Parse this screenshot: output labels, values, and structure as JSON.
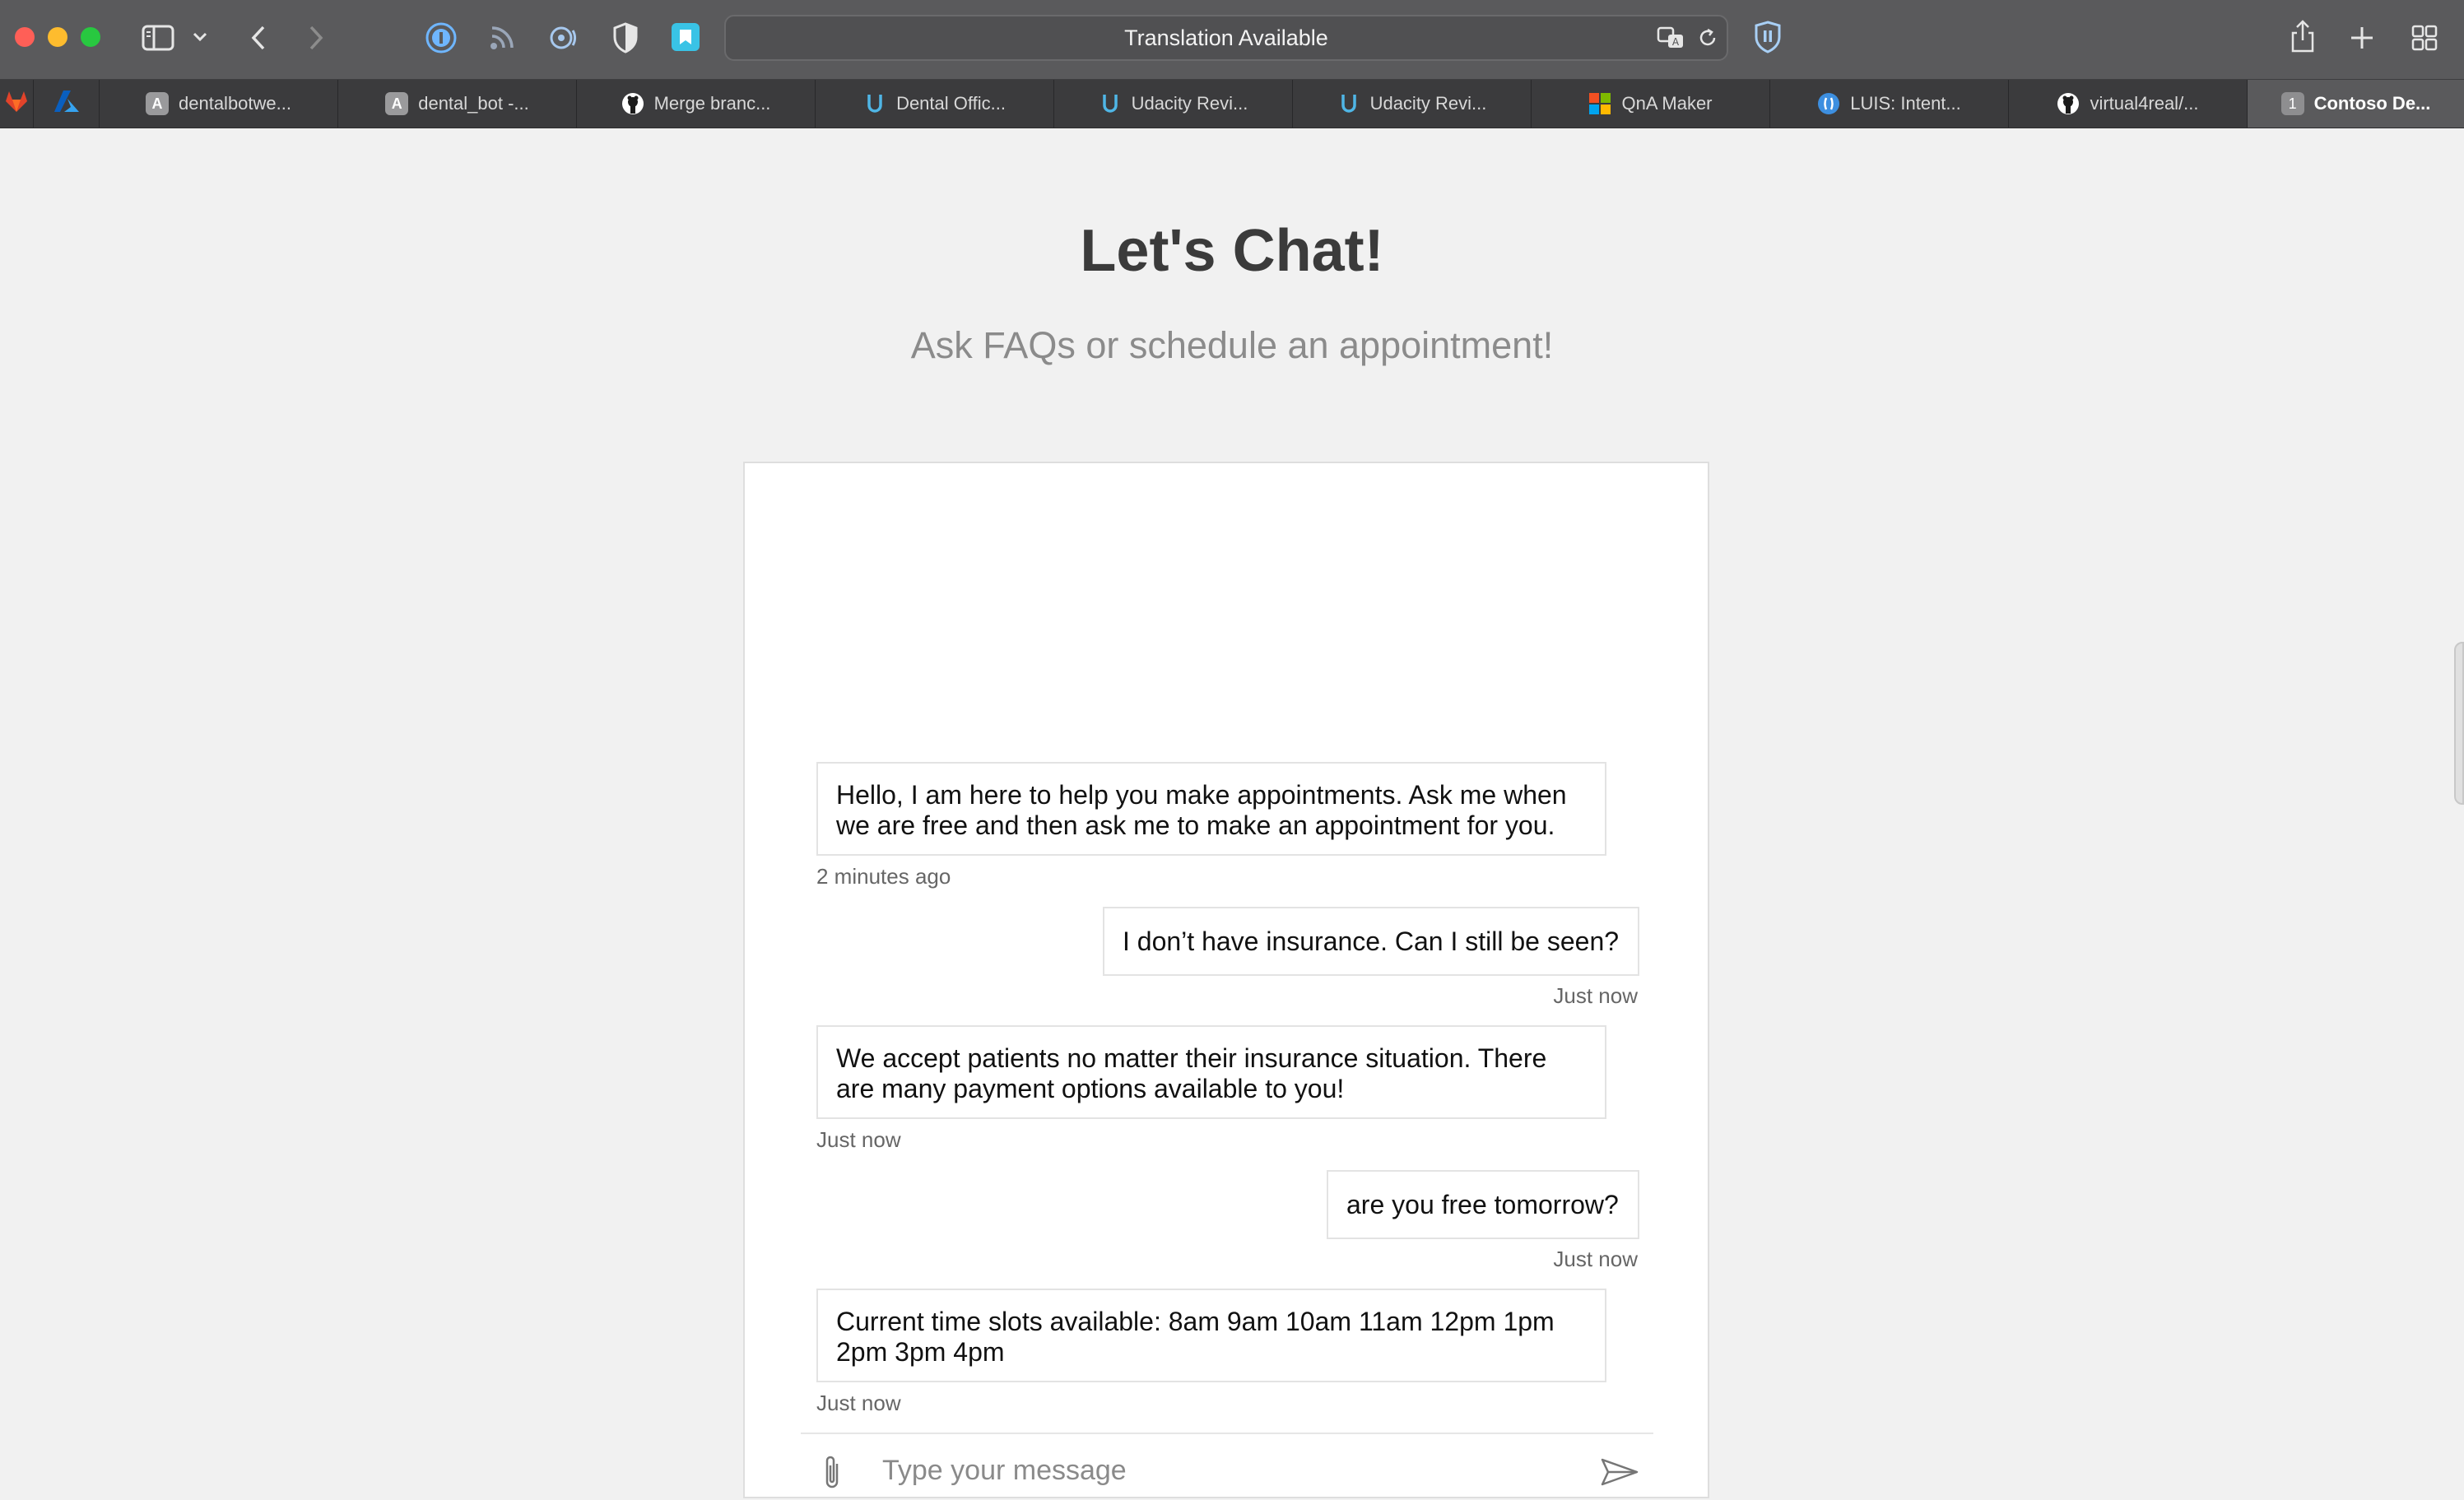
{
  "browser": {
    "address_text": "Translation Available",
    "colors": {
      "toolbar": "#5a5a5c",
      "tabbar": "#3b3b3d",
      "close": "#ff5f57",
      "minimize": "#febc2e",
      "zoom": "#28c840"
    },
    "tabs": [
      {
        "label": "dentalbotwe...",
        "icon": "azure-a-icon"
      },
      {
        "label": "dental_bot -...",
        "icon": "azure-a-icon"
      },
      {
        "label": "Merge branc...",
        "icon": "github-icon"
      },
      {
        "label": "Dental Offic...",
        "icon": "udacity-icon"
      },
      {
        "label": "Udacity Revi...",
        "icon": "udacity-icon"
      },
      {
        "label": "Udacity Revi...",
        "icon": "udacity-icon"
      },
      {
        "label": "QnA Maker",
        "icon": "microsoft-icon"
      },
      {
        "label": "LUIS: Intent...",
        "icon": "luis-icon"
      },
      {
        "label": "virtual4real/...",
        "icon": "github-icon"
      },
      {
        "label": "Contoso De...",
        "icon": "numbered-tab-icon",
        "badge": "1",
        "active": true
      }
    ]
  },
  "page": {
    "title": "Let's Chat!",
    "subtitle": "Ask FAQs or schedule an appointment!"
  },
  "chat": {
    "messages": [
      {
        "from": "bot",
        "line1": "Hello, I am here to help you make appointments. Ask me when",
        "line2": "we are free and then ask me to make an appointment for you.",
        "time": "2 minutes ago"
      },
      {
        "from": "user",
        "text": "I don’t have insurance. Can I still be seen?",
        "time": "Just now"
      },
      {
        "from": "bot",
        "line1": "We accept patients no matter their insurance situation. There",
        "line2": "are many payment options available to you!",
        "time": "Just now"
      },
      {
        "from": "user",
        "text": "are you free tomorrow?",
        "time": "Just now"
      },
      {
        "from": "bot",
        "line1": "Current time slots available: 8am 9am 10am 11am 12pm 1pm",
        "line2": "2pm 3pm 4pm",
        "time": "Just now"
      }
    ],
    "input_placeholder": "Type your message",
    "input_value": ""
  }
}
